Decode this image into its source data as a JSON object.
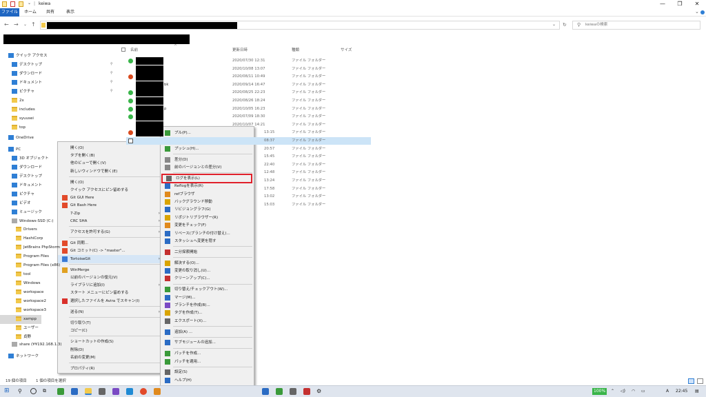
{
  "window": {
    "title": "keiwa",
    "minimize": "—",
    "maximize": "❐",
    "close": "✕"
  },
  "ribbon": {
    "tabs": [
      "ファイル",
      "ホーム",
      "共有",
      "表示"
    ]
  },
  "nav_buttons": {
    "back": "←",
    "forward": "→",
    "recent": "⌄",
    "up": "↑",
    "dropdown": "⌄",
    "refresh": "↻"
  },
  "search": {
    "placeholder": "keiwaの検索",
    "icon": "search-icon"
  },
  "columns": {
    "name": "名前",
    "date": "更新日時",
    "type": "種類",
    "size": "サイズ"
  },
  "nav_pane": {
    "quick_access": "クイック アクセス",
    "items": [
      {
        "label": "デスクトップ",
        "icon": "desktop",
        "pinned": true
      },
      {
        "label": "ダウンロード",
        "icon": "download",
        "pinned": true
      },
      {
        "label": "ドキュメント",
        "icon": "documents",
        "pinned": true
      },
      {
        "label": "ピクチャ",
        "icon": "pictures",
        "pinned": true
      },
      {
        "label": "2x",
        "icon": "folder"
      },
      {
        "label": "includes",
        "icon": "folder"
      },
      {
        "label": "syuusei",
        "icon": "folder"
      },
      {
        "label": "top",
        "icon": "folder"
      }
    ],
    "onedrive": "OneDrive",
    "pc": "PC",
    "pc_items": [
      "3D オブジェクト",
      "ダウンロード",
      "デスクトップ",
      "ドキュメント",
      "ピクチャ",
      "ビデオ",
      "ミュージック",
      "Windows-SSD (C:)"
    ],
    "drive_items": [
      "Drivers",
      "HashiCorp",
      "JetBrains PhpStorm",
      "Program Files",
      "Program Files (x86)",
      "tool",
      "Windows",
      "workspace",
      "workspace2",
      "workspace3",
      "xampp",
      "ユーザー",
      "貞野"
    ],
    "share": "share (¥¥192.168.1.3)",
    "network": "ネットワーク"
  },
  "files": [
    {
      "date": "2020/07/30 12:31",
      "type": "ファイル フォルダー",
      "badge": "green"
    },
    {
      "date": "2020/10/08 13:07",
      "type": "ファイル フォルダー",
      "badge": "none"
    },
    {
      "date": "2020/08/11 10:49",
      "type": "ファイル フォルダー",
      "badge": "red"
    },
    {
      "date": "2020/09/14 16:47",
      "type": "ファイル フォルダー",
      "badge": "none",
      "suffix": "bk"
    },
    {
      "date": "2020/08/25 22:23",
      "type": "ファイル フォルダー",
      "badge": "green"
    },
    {
      "date": "2020/08/26 18:24",
      "type": "ファイル フォルダー",
      "badge": "green"
    },
    {
      "date": "2020/10/05 16:23",
      "type": "ファイル フォルダー",
      "badge": "green",
      "suffix": "p"
    },
    {
      "date": "2020/07/09 18:30",
      "type": "ファイル フォルダー",
      "badge": "green"
    },
    {
      "date": "2020/10/07 14:21",
      "type": "ファイル フォルダー",
      "badge": "none"
    },
    {
      "date": "13:15",
      "type": "ファイル フォルダー",
      "badge": "red"
    },
    {
      "date": "08:37",
      "type": "ファイル フォルダー",
      "badge": "check",
      "selected": true
    },
    {
      "date": "20:57",
      "type": "ファイル フォルダー"
    },
    {
      "date": "15:45",
      "type": "ファイル フォルダー"
    },
    {
      "date": "22:40",
      "type": "ファイル フォルダー"
    },
    {
      "date": "12:48",
      "type": "ファイル フォルダー"
    },
    {
      "date": "13:24",
      "type": "ファイル フォルダー"
    },
    {
      "date": "17:58",
      "type": "ファイル フォルダー"
    },
    {
      "date": "13:02",
      "type": "ファイル フォルダー"
    },
    {
      "date": "15:03",
      "type": "ファイル フォルダー"
    }
  ],
  "context_menu": [
    {
      "label": "開く(O)"
    },
    {
      "label": "タブを開く(B)"
    },
    {
      "label": "他のビューで開く(V)"
    },
    {
      "label": "新しいウィンドウで開く(E)"
    },
    {
      "sep": true
    },
    {
      "label": "開く(O)"
    },
    {
      "label": "クイック アクセスにピン留めする"
    },
    {
      "label": "Git GUI Here",
      "icon": "git"
    },
    {
      "label": "Git Bash Here",
      "icon": "git"
    },
    {
      "label": "7-Zip",
      "sub": true
    },
    {
      "label": "CRC SHA",
      "sub": true
    },
    {
      "sep": true
    },
    {
      "label": "アクセスを許可する(G)",
      "sub": true
    },
    {
      "sep": true
    },
    {
      "label": "Git 同期...",
      "icon": "git"
    },
    {
      "label": "Git コミット(C) -> \"master\"...",
      "icon": "git"
    },
    {
      "label": "TortoiseGit",
      "icon": "tortoise",
      "sub": true,
      "hover": true
    },
    {
      "sep": true
    },
    {
      "label": "WinMerge",
      "icon": "winmerge"
    },
    {
      "label": "以前のバージョンの復元(V)"
    },
    {
      "label": "ライブラリに追加(I)",
      "sub": true
    },
    {
      "label": "スタート メニューにピン留めする"
    },
    {
      "label": "選択したファイルを Avira でスキャン(I)",
      "icon": "avira"
    },
    {
      "sep": true
    },
    {
      "label": "送る(N)",
      "sub": true
    },
    {
      "sep": true
    },
    {
      "label": "切り取り(T)"
    },
    {
      "label": "コピー(C)"
    },
    {
      "sep": true
    },
    {
      "label": "ショートカットの作成(S)"
    },
    {
      "label": "削除(D)"
    },
    {
      "label": "名前の変更(M)"
    },
    {
      "sep": true
    },
    {
      "label": "プロパティ(R)"
    }
  ],
  "tortoise_menu": [
    {
      "label": "プル(P)...",
      "color": "#3a9a3a"
    },
    {
      "label": "フェッチ(F)...",
      "color": "#3a9a3a"
    },
    {
      "label": "プッシュ(H)...",
      "color": "#3a9a3a"
    },
    {
      "sep": true
    },
    {
      "label": "差分(D)",
      "color": "#888"
    },
    {
      "label": "前のバージョンとの差分(V)",
      "color": "#888"
    },
    {
      "sep": true
    },
    {
      "label": "ログを表示(L)",
      "color": "#666",
      "highlight": true
    },
    {
      "label": "Reflogを表示(R)",
      "color": "#2b6cc4"
    },
    {
      "label": "refブラウザ",
      "color": "#e08a1e"
    },
    {
      "label": "バックグラウンド移動",
      "color": "#d9a400"
    },
    {
      "label": "リビジョングラフ(G)",
      "color": "#2b6cc4"
    },
    {
      "label": "リポジトリブラウザー(R)",
      "color": "#d9a400"
    },
    {
      "label": "変更をチェック(F)",
      "color": "#e08a1e"
    },
    {
      "label": "リベース(ブランチの付け替え)...",
      "color": "#2b6cc4"
    },
    {
      "label": "スタッシュへ変更を隠す",
      "color": "#2b6cc4"
    },
    {
      "sep": true
    },
    {
      "label": "二分探索開始",
      "color": "#c43030"
    },
    {
      "sep": true
    },
    {
      "label": "解決する(O)...",
      "color": "#d9a400"
    },
    {
      "label": "変更の取り消し(U)...",
      "color": "#2b6cc4"
    },
    {
      "label": "クリーンアップ(C)...",
      "color": "#c43030"
    },
    {
      "sep": true
    },
    {
      "label": "切り替え/チェックアウト(W)...",
      "color": "#3a9a3a"
    },
    {
      "label": "マージ(M)...",
      "color": "#2b6cc4"
    },
    {
      "label": "ブランチを作成(B)...",
      "color": "#7a4ac4"
    },
    {
      "label": "タグを作成(T)...",
      "color": "#d9a400"
    },
    {
      "label": "エクスポート(X)...",
      "color": "#666"
    },
    {
      "sep": true
    },
    {
      "label": "追加(A) ...",
      "color": "#2b6cc4"
    },
    {
      "sep": true
    },
    {
      "label": "サブモジュールの追加...",
      "color": "#2b6cc4"
    },
    {
      "sep": true
    },
    {
      "label": "パッチを作成...",
      "color": "#3a9a3a"
    },
    {
      "label": "パッチを適用...",
      "color": "#3a9a3a"
    },
    {
      "sep": true
    },
    {
      "label": "設定(S)",
      "color": "#666"
    },
    {
      "label": "ヘルプ(H)",
      "color": "#2b6cc4"
    },
    {
      "label": "TortoiseGit について(B)",
      "color": "#2b6cc4"
    }
  ],
  "status": {
    "count": "19 個の項目",
    "selected": "1 個の項目を選択"
  },
  "taskbar": {
    "battery": "100%",
    "time": "22:45",
    "lang": "A"
  }
}
